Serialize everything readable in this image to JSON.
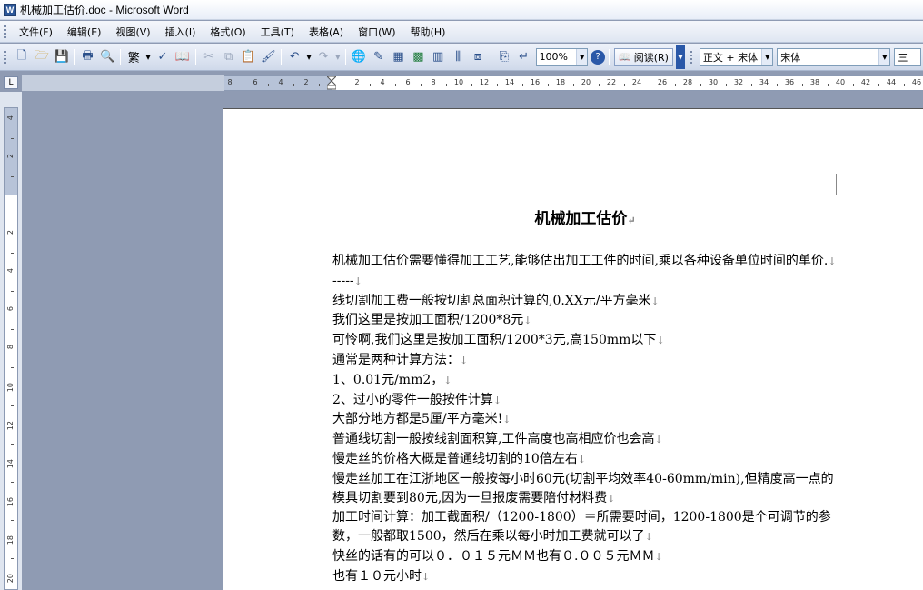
{
  "window": {
    "title": "机械加工估价.doc - Microsoft Word",
    "app_icon": "W"
  },
  "menu": [
    "文件(F)",
    "编辑(E)",
    "视图(V)",
    "插入(I)",
    "格式(O)",
    "工具(T)",
    "表格(A)",
    "窗口(W)",
    "帮助(H)"
  ],
  "toolbar": {
    "zoom": "100%",
    "read_label": "阅读(R)",
    "style": "正文 + 宋体",
    "font": "宋体",
    "extra": "三"
  },
  "ruler": {
    "corner": "L",
    "h_labels": [
      "8",
      "6",
      "4",
      "2",
      "2",
      "4",
      "6",
      "8",
      "10",
      "12",
      "14",
      "16",
      "18",
      "20",
      "22",
      "24",
      "26",
      "28",
      "30",
      "32",
      "34",
      "36",
      "38",
      "40",
      "42",
      "44",
      "46"
    ],
    "v_labels": [
      "4",
      "2",
      "2",
      "4",
      "6",
      "8",
      "10",
      "12",
      "14",
      "16",
      "18",
      "20"
    ]
  },
  "document": {
    "title": "机械加工估价",
    "paragraphs": [
      "机械加工估价需要懂得加工工艺,能够估出加工工件的时间,乘以各种设备单位时间的单价.",
      "-----",
      "线切割加工费一般按切割总面积计算的,0.XX元/平方毫米",
      "我们这里是按加工面积/1200*8元",
      "可怜啊,我们这里是按加工面积/1200*3元,高150mm以下",
      "通常是两种计算方法：",
      "1、0.01元/mm2，",
      "2、过小的零件一般按件计算",
      "大部分地方都是5厘/平方毫米!",
      "普通线切割一般按线割面积算,工件高度也高相应价也会高",
      "慢走丝的价格大概是普通线切割的10倍左右",
      "慢走丝加工在江浙地区一般按每小时60元(切割平均效率40-60mm/min),但精度高一点的模具切割要到80元,因为一旦报废需要陪付材料费",
      "加工时间计算：加工截面积/（1200-1800）＝所需要时间，1200-1800是个可调节的参数，一般都取1500，然后在乘以每小时加工费就可以了",
      "快丝的话有的可以０．０１５元ＭＭ也有０.００５元ＭＭ",
      "也有１０元小时"
    ]
  }
}
